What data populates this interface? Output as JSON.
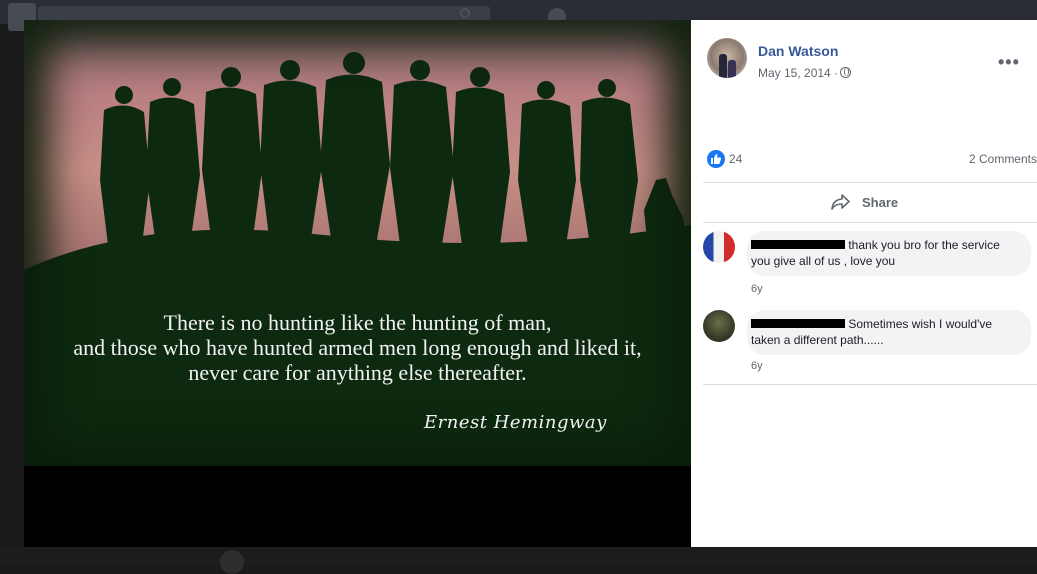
{
  "post": {
    "author_name": "Dan Watson",
    "date": "May 15, 2014 ·",
    "more_label": "•••",
    "like_count": "24",
    "comments_count": "2 Comments",
    "share_label": "Share"
  },
  "photo": {
    "quote_lines": [
      "There is no hunting like the hunting of man,",
      "and those who have hunted armed men long enough and liked it,",
      "never care for anything else thereafter."
    ],
    "attribution": "Ernest Hemingway"
  },
  "comments": [
    {
      "text": "thank you bro for the service you give all of us , love you",
      "time": "6y"
    },
    {
      "text": "Sometimes wish I would've taken a different path......",
      "time": "6y"
    }
  ],
  "colors": {
    "link_blue": "#385898",
    "like_blue": "#1877f2"
  },
  "icons": [
    "globe-icon",
    "like-icon",
    "share-icon",
    "more-icon"
  ]
}
